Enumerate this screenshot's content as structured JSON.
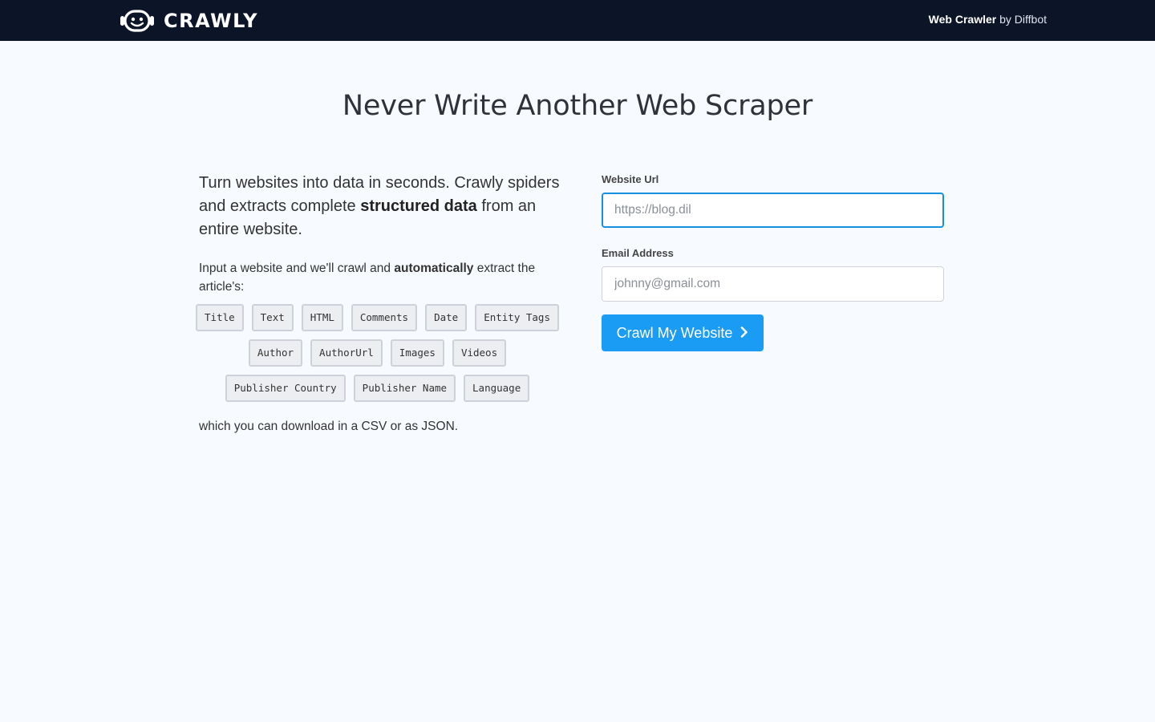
{
  "nav": {
    "brand": "CRAWLY",
    "logo_icon": "robot-face-icon",
    "right_strong": "Web Crawler",
    "right_light": " by Diffbot"
  },
  "hero": {
    "title": "Never Write Another Web Scraper"
  },
  "intro": {
    "lead_part1": "Turn websites into data in seconds. Crawly spiders and extracts complete ",
    "lead_bold": "structured data",
    "lead_part2": " from an entire website.",
    "sub_part1": "Input a website and we'll crawl and ",
    "sub_bold": "automatically",
    "sub_part2": " extract the article's:",
    "tags_row1": [
      "Title",
      "Text",
      "HTML",
      "Comments",
      "Date",
      "Entity Tags"
    ],
    "tags_row2": [
      "Author",
      "AuthorUrl",
      "Images",
      "Videos"
    ],
    "tags_row3": [
      "Publisher Country",
      "Publisher Name",
      "Language"
    ],
    "note": "which you can download in a CSV or as JSON."
  },
  "form": {
    "url_label": "Website Url",
    "url_placeholder": "https://blog.dil",
    "email_label": "Email Address",
    "email_placeholder": "johnny@gmail.com",
    "submit_label": "Crawl My Website",
    "submit_icon": "chevron-right-icon"
  },
  "colors": {
    "navbar": "#0c1427",
    "accent": "#1a9cf5",
    "background": "#f7faff"
  }
}
